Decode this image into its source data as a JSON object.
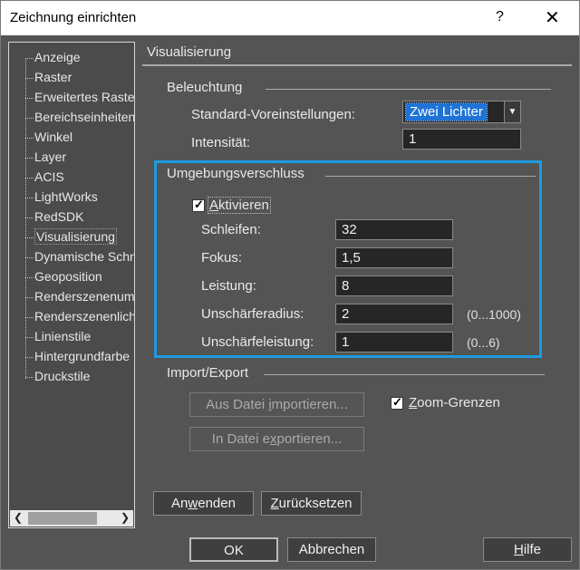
{
  "window": {
    "title": "Zeichnung einrichten",
    "help_glyph": "?",
    "close_glyph": "✕"
  },
  "tree": {
    "items": [
      {
        "label": "Anzeige"
      },
      {
        "label": "Raster"
      },
      {
        "label": "Erweitertes Raster"
      },
      {
        "label": "Bereichseinheiten"
      },
      {
        "label": "Winkel"
      },
      {
        "label": "Layer"
      },
      {
        "label": "ACIS"
      },
      {
        "label": "LightWorks"
      },
      {
        "label": "RedSDK"
      },
      {
        "label": "Visualisierung",
        "selected": true
      },
      {
        "label": "Dynamische Schnitte"
      },
      {
        "label": "Geoposition"
      },
      {
        "label": "Renderszenenumgebung"
      },
      {
        "label": "Renderszenenlicht"
      },
      {
        "label": "Linienstile"
      },
      {
        "label": "Hintergrundfarbe"
      },
      {
        "label": "Druckstile"
      }
    ]
  },
  "section": {
    "title": "Visualisierung"
  },
  "beleuchtung": {
    "group_label": "Beleuchtung",
    "preset_label": "Standard-Voreinstellungen:",
    "preset_value": "Zwei Lichter",
    "intensity_label": "Intensität:",
    "intensity_value": "1"
  },
  "ambient_occlusion": {
    "group_label": "Umgebungsverschluss",
    "enable": {
      "label_prefix": "",
      "label_underlined": "A",
      "label_rest": "ktivieren",
      "checked": true
    },
    "fields": [
      {
        "label": "Schleifen:",
        "value": "32",
        "hint": ""
      },
      {
        "label": "Fokus:",
        "value": "1,5",
        "hint": ""
      },
      {
        "label": "Leistung:",
        "value": "8",
        "hint": ""
      },
      {
        "label": "Unschärferadius:",
        "value": "2",
        "hint": "(0...1000)"
      },
      {
        "label": "Unschärfeleistung:",
        "value": "1",
        "hint": "(0...6)"
      }
    ]
  },
  "import_export": {
    "group_label": "Import/Export",
    "import_btn": {
      "pre": "Aus Datei ",
      "u": "i",
      "post": "mportieren..."
    },
    "export_btn": {
      "pre": "In Datei e",
      "u": "x",
      "post": "portieren..."
    },
    "zoom": {
      "u": "Z",
      "post": "oom-Grenzen",
      "checked": true
    }
  },
  "actions": {
    "apply": {
      "pre": "An",
      "u": "w",
      "post": "enden"
    },
    "reset": {
      "pre": "",
      "u": "Z",
      "post": "urücksetzen"
    }
  },
  "footer": {
    "ok": "OK",
    "cancel": "Abbrechen",
    "help": {
      "u": "H",
      "post": "ilfe"
    }
  },
  "colors": {
    "dialog_bg": "#545454",
    "highlight": "#1f9be0",
    "selection": "#1e73d6"
  }
}
